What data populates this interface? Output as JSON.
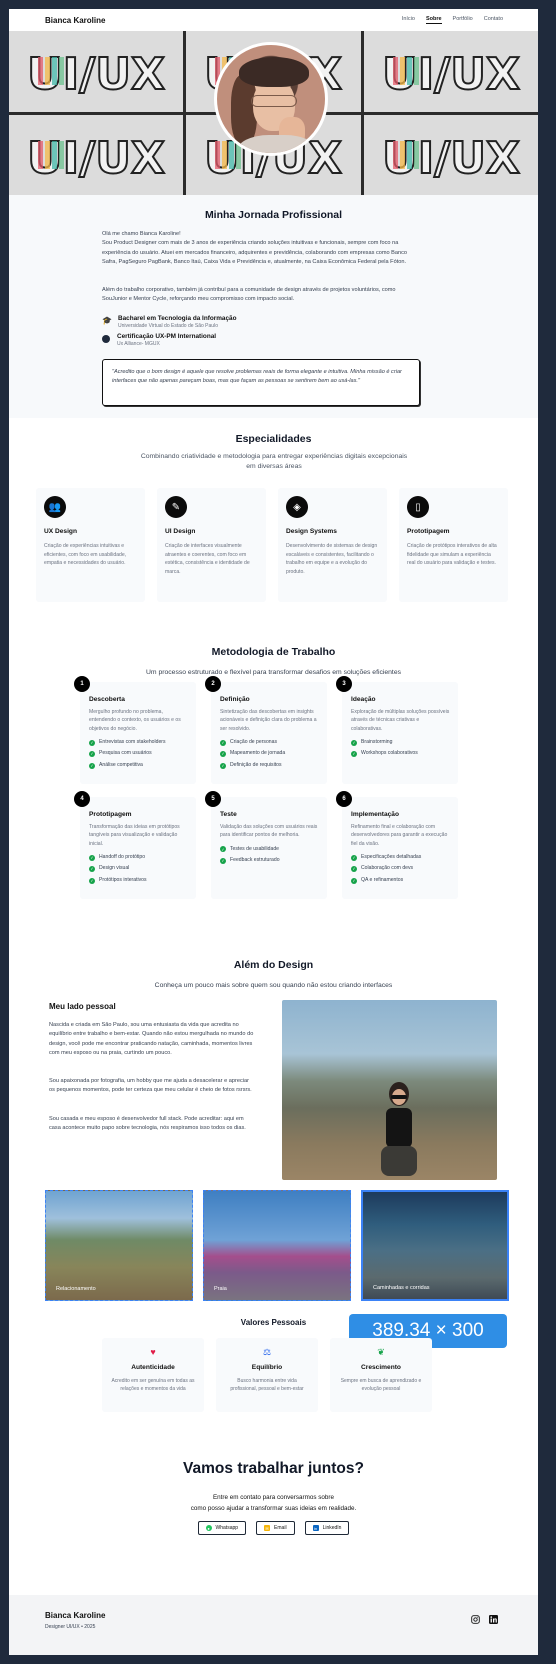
{
  "nav": {
    "brand": "Bianca Karoline",
    "links": [
      "Início",
      "Sobre",
      "Portfólio",
      "Contato"
    ]
  },
  "hero": {
    "tile_text": "UI/UX"
  },
  "journey": {
    "title": "Minha Jornada Profissional",
    "intro_line1": "Olá me chamo Bianca Karoline!",
    "intro_line2": "Sou Product Designer com mais de 3 anos de experiência criando soluções intuitivas e funcionais, sempre com foco na experiência do usuário. Atuei em mercados financeiro, adquirentes e previdência, colaborando com empresas como Banco Safra, PagSeguro PagBank, Banco Itaú, Caixa Vida e Previdência e, atualmente, na Caixa Econômica Federal pela Fóton.",
    "para2": "Além do trabalho corporativo, também já contribuí para a comunidade de design através de projetos voluntários, como SouJunior e Mentor Cycle, reforçando meu compromisso com impacto social.",
    "education": [
      {
        "title": "Bacharel em Tecnologia da Informação",
        "subtitle": "Universidade Virtual do Estado de São Paulo"
      },
      {
        "title": "Certificação UX-PM International",
        "subtitle": "Ux Alliance- MGUX"
      }
    ],
    "quote": "\"Acredito que o bom design é aquele que resolve problemas reais de forma elegante e intuitiva. Minha missão é criar interfaces que não apenas pareçam boas, mas que façam as pessoas se sentirem bem ao usá-las.\""
  },
  "specialties": {
    "title": "Especialidades",
    "subtitle": "Combinando criatividade e metodologia para entregar experiências digitais excepcionais em diversas áreas",
    "cards": [
      {
        "icon": "users-icon",
        "title": "UX Design",
        "desc": "Criação de experiências intuitivas e eficientes, com foco em usabilidade, empatia e necessidades do usuário."
      },
      {
        "icon": "brush-icon",
        "title": "UI Design",
        "desc": "Criação de interfaces visualmente atraentes e coerentes, com foco em estética, consistência e identidade de marca."
      },
      {
        "icon": "layers-icon",
        "title": "Design Systems",
        "desc": "Desenvolvimento de sistemas de design escaláveis e consistentes, facilitando o trabalho em equipe e a evolução do produto."
      },
      {
        "icon": "mobile-icon",
        "title": "Prototipagem",
        "desc": "Criação de protótipos interativos de alta fidelidade que simulam a experiência real do usuário para validação e testes."
      }
    ]
  },
  "methodology": {
    "title": "Metodologia de Trabalho",
    "subtitle": "Um processo estruturado e flexível para transformar desafios em soluções eficientes",
    "steps": [
      {
        "num": "1",
        "title": "Descoberta",
        "desc": "Mergulho profundo no problema, entendendo o contexto, os usuários e os objetivos do negócio.",
        "items": [
          "Entrevistas com stakeholders",
          "Pesquisa com usuários",
          "Análise competitiva"
        ]
      },
      {
        "num": "2",
        "title": "Definição",
        "desc": "Sintetização das descobertas em insights acionáveis e definição clara do problema a ser resolvido.",
        "items": [
          "Criação de personas",
          "Mapeamento de jornada",
          "Definição de requisitos"
        ]
      },
      {
        "num": "3",
        "title": "Ideação",
        "desc": "Exploração de múltiplas soluções possíveis através de técnicas criativas e colaborativas.",
        "items": [
          "Brainstorming",
          "Workshops colaborativos"
        ]
      },
      {
        "num": "4",
        "title": "Prototipagem",
        "desc": "Transformação das ideias em protótipos tangíveis para visualização e validação inicial.",
        "items": [
          "Handoff do protótipo",
          "Design visual",
          "Protótipos interativos"
        ]
      },
      {
        "num": "5",
        "title": "Teste",
        "desc": "Validação das soluções com usuários reais para identificar pontos de melhoria.",
        "items": [
          "Testes de usabilidade",
          "Feedback estruturado"
        ]
      },
      {
        "num": "6",
        "title": "Implementação",
        "desc": "Refinamento final e colaboração com desenvolvedores para garantir a execução fiel da visão.",
        "items": [
          "Especificações detalhadas",
          "Colaboração com devs",
          "QA e refinamentos"
        ]
      }
    ]
  },
  "beyond": {
    "title": "Além do Design",
    "subtitle": "Conheça um pouco mais sobre quem sou quando não estou criando interfaces",
    "personal_title": "Meu lado pessoal",
    "p1": "Nascida e criada em São Paulo, sou uma entusiasta da vida que acredita no equilíbrio entre trabalho e bem-estar. Quando não estou mergulhada no mundo do design, você pode me encontrar praticando natação, caminhada, momentos livres com meu esposo ou na praia, curtindo um pouco.",
    "p2": "Sou apaixonada por fotografia, um hobby que me ajuda a desacelerar e apreciar os pequenos momentos, pode ter certeza que meu celular é cheio de fotos rsrsrs.",
    "p3": "Sou casada e meu esposo é desenvolvedor full stack. Pode acreditar: aqui em casa acontece muito papo sobre tecnologia, nós respiramos isso todos os dias.",
    "gallery": [
      "Relacionamento",
      "Praia",
      "Caminhadas e corridas"
    ],
    "size_badge": "389.34 × 300",
    "values_title": "Valores Pessoais",
    "values": [
      {
        "icon": "heart-icon",
        "title": "Autenticidade",
        "desc": "Acredito em ser genuína em todas as relações e momentos da vida"
      },
      {
        "icon": "scale-icon",
        "title": "Equilíbrio",
        "desc": "Busco harmonia entre vida profissional, pessoal e bem-estar"
      },
      {
        "icon": "sprout-icon",
        "title": "Crescimento",
        "desc": "Sempre em busca de aprendizado e evolução pessoal"
      }
    ]
  },
  "cta": {
    "title": "Vamos trabalhar juntos?",
    "line1": "Entre em contato para conversarmos sobre",
    "line2": "como posso ajudar a transformar suas ideias em realidade.",
    "buttons": [
      "Whatsapp",
      "Email",
      "LinkedIn"
    ]
  },
  "footer": {
    "name": "Bianca Karoline",
    "sub": "Designer UI/UX • 2025"
  },
  "colors": {
    "accent_green": "#16a34a",
    "selection_blue": "#2f8ee5",
    "page_bg": "#1f2a3c"
  }
}
